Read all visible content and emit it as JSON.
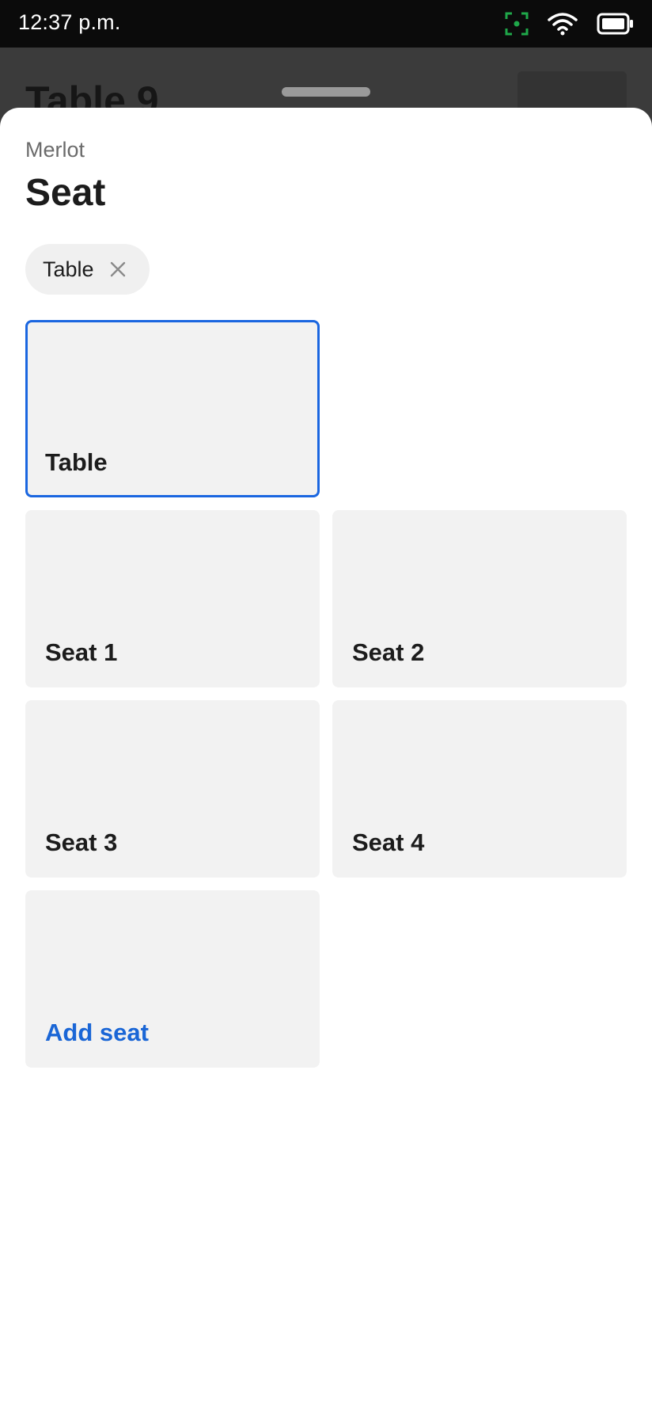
{
  "status_bar": {
    "time": "12:37 p.m.",
    "icons": [
      "screen-record-icon",
      "wifi-icon",
      "battery-icon"
    ],
    "record_icon_color": "#1fa84a"
  },
  "background": {
    "title": "Table 9"
  },
  "sheet": {
    "subtitle": "Merlot",
    "title": "Seat",
    "filter_chip": {
      "label": "Table",
      "icon": "close-icon"
    },
    "tiles": [
      {
        "label": "Table",
        "selected": true
      },
      {
        "label": "Seat 1"
      },
      {
        "label": "Seat 2"
      },
      {
        "label": "Seat 3"
      },
      {
        "label": "Seat 4"
      },
      {
        "label": "Add seat",
        "action": true
      }
    ],
    "accent_color": "#1a66e0"
  }
}
